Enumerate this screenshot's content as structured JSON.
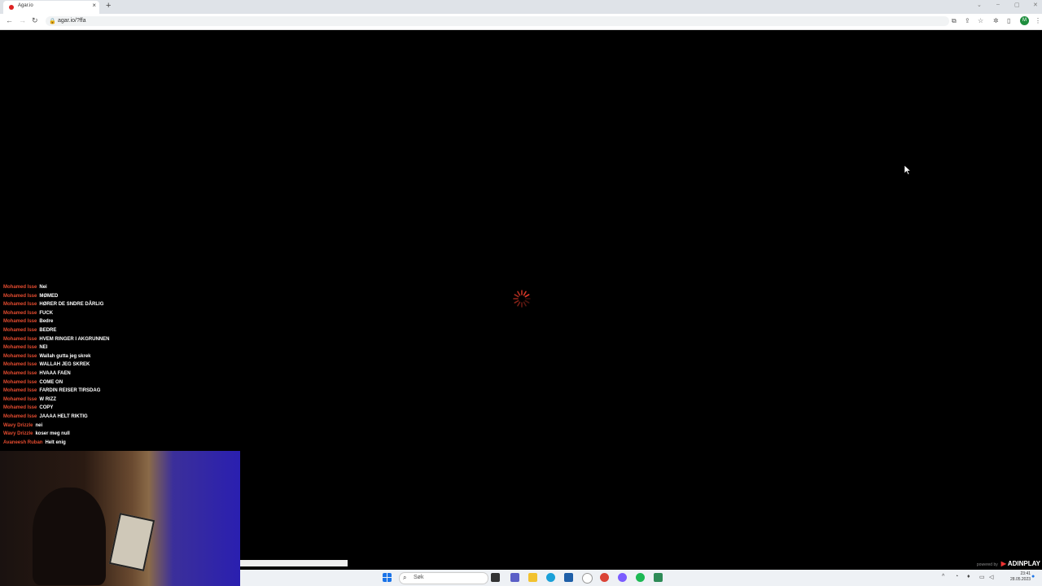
{
  "browser": {
    "tab_title": "Agar.io",
    "url": "agar.io/?ffa",
    "profile_initial": "M"
  },
  "chat": [
    {
      "name": "Mohamed Isse",
      "text": "Nei"
    },
    {
      "name": "Mohamed Isse",
      "text": "MØMED"
    },
    {
      "name": "Mohamed Isse",
      "text": "HØRER DE SNDRE DÅRLIG"
    },
    {
      "name": "Mohamed Isse",
      "text": "FUCK"
    },
    {
      "name": "Mohamed Isse",
      "text": "Bedre"
    },
    {
      "name": "Mohamed Isse",
      "text": "BEDRE"
    },
    {
      "name": "Mohamed Isse",
      "text": "HVEM RINGER I AKGRUNNEN"
    },
    {
      "name": "Mohamed Isse",
      "text": "NEI"
    },
    {
      "name": "Mohamed Isse",
      "text": "Wallah gutta jeg skrek"
    },
    {
      "name": "Mohamed Isse",
      "text": "WALLAH JEG SKREK"
    },
    {
      "name": "Mohamed Isse",
      "text": "HVAAA FAEN"
    },
    {
      "name": "Mohamed Isse",
      "text": "COME ON"
    },
    {
      "name": "Mohamed Isse",
      "text": "FARDIN REISER TIRSDAG"
    },
    {
      "name": "Mohamed Isse",
      "text": "W RIZZ"
    },
    {
      "name": "Mohamed Isse",
      "text": "COPY"
    },
    {
      "name": "Mohamed Isse",
      "text": "JAAAA HELT RIKTIG"
    },
    {
      "name": "Wavy Drizzle",
      "text": "nei"
    },
    {
      "name": "Wavy Drizzle",
      "text": "koser meg null"
    },
    {
      "name": "Avaneesh Ruban",
      "text": "Helt enig"
    }
  ],
  "ad": {
    "powered_by": "powered by",
    "brand": "ADINPLAY"
  },
  "taskbar": {
    "search_label": "Søk",
    "clock_time": "23:41",
    "clock_date": "28.05.2023"
  },
  "load_progress": 0.134,
  "colors": {
    "chat_name": "#e34b2f",
    "spinner": "#e33b2a"
  }
}
